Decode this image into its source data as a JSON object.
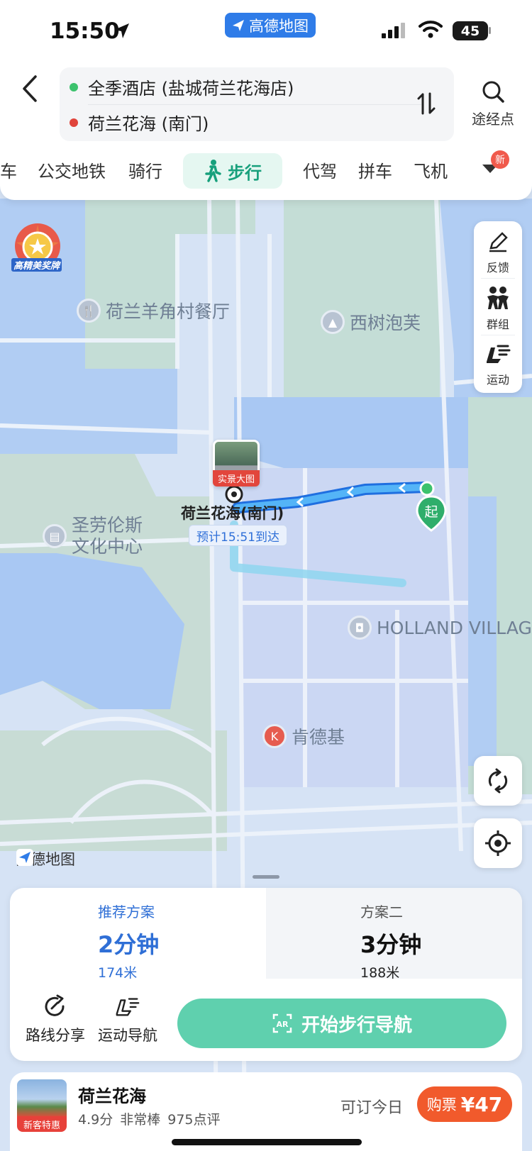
{
  "status_bar": {
    "time": "15:50",
    "app_label": "高德地图",
    "battery": "45"
  },
  "route": {
    "origin": "全季酒店 (盐城荷兰花海店)",
    "destination": "荷兰花海 (南门)",
    "origin_color": "#3cc26d",
    "destination_color": "#e0443b",
    "waypoint_label": "途经点"
  },
  "modes": {
    "partial": "车",
    "items": [
      "公交地铁",
      "骑行",
      "步行",
      "代驾",
      "拼车",
      "飞机"
    ],
    "active": "步行",
    "new_badge": "新"
  },
  "medal": {
    "label": "高精美奖牌"
  },
  "side_tools": [
    {
      "icon": "feedback-icon",
      "label": "反馈"
    },
    {
      "icon": "group-icon",
      "label": "群组"
    },
    {
      "icon": "sport-icon",
      "label": "运动"
    }
  ],
  "map": {
    "logo": "高德地图",
    "pois": {
      "restaurant": "荷兰羊角村餐厅",
      "xishu": "西树泡芙",
      "culture_line1": "圣劳伦斯",
      "culture_line2": "文化中心",
      "holland": "HOLLAND VILLAGE",
      "kfc": "肯德基"
    },
    "destination_label": "荷兰花海(南门)",
    "eta": "预计15:51到达",
    "streetview_label": "实景大图",
    "start_marker": "起",
    "route_color": "#3f8ff0"
  },
  "plans": [
    {
      "title": "推荐方案",
      "time": "2分钟",
      "distance": "174米"
    },
    {
      "title": "方案二",
      "time": "3分钟",
      "distance": "188米"
    }
  ],
  "actions": {
    "share": "路线分享",
    "sport_nav": "运动导航",
    "start": "开始步行导航"
  },
  "ticket": {
    "name": "荷兰花海",
    "badge": "新客特惠",
    "score": "4.9分",
    "rating": "非常棒",
    "reviews": "975点评",
    "availability": "可订今日",
    "buy_label": "购票",
    "price": "¥47"
  }
}
